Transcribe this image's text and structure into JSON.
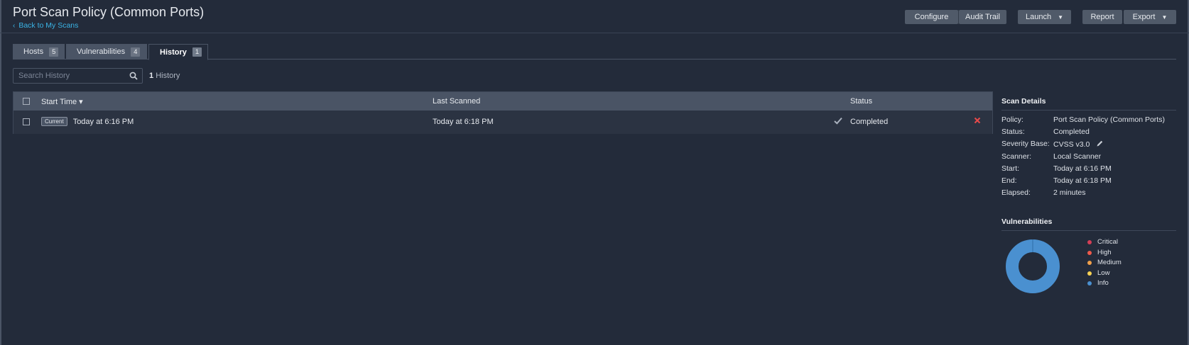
{
  "header": {
    "title": "Port Scan Policy (Common Ports)",
    "back_link": "Back to My Scans",
    "buttons": {
      "configure": "Configure",
      "audit_trail": "Audit Trail",
      "launch": "Launch",
      "report": "Report",
      "export": "Export"
    }
  },
  "tabs": [
    {
      "label": "Hosts",
      "count": "5"
    },
    {
      "label": "Vulnerabilities",
      "count": "4"
    },
    {
      "label": "History",
      "count": "1"
    }
  ],
  "search": {
    "placeholder": "Search History",
    "result_count": "1",
    "result_label": "History"
  },
  "table": {
    "columns": [
      "Start Time ▾",
      "Last Scanned",
      "Status"
    ],
    "rows": [
      {
        "badge": "Current",
        "start_time": "Today at 6:16 PM",
        "last_scanned": "Today at 6:18 PM",
        "status": "Completed"
      }
    ]
  },
  "scan_details": {
    "title": "Scan Details",
    "items": [
      {
        "label": "Policy:",
        "value": "Port Scan Policy (Common Ports)"
      },
      {
        "label": "Status:",
        "value": "Completed"
      },
      {
        "label": "Severity Base:",
        "value": "CVSS v3.0"
      },
      {
        "label": "Scanner:",
        "value": "Local Scanner"
      },
      {
        "label": "Start:",
        "value": "Today at 6:16 PM"
      },
      {
        "label": "End:",
        "value": "Today at 6:18 PM"
      },
      {
        "label": "Elapsed:",
        "value": "2 minutes"
      }
    ]
  },
  "vulnerabilities": {
    "title": "Vulnerabilities",
    "legend": [
      {
        "label": "Critical",
        "color": "#d43f56"
      },
      {
        "label": "High",
        "color": "#ee5a4b"
      },
      {
        "label": "Medium",
        "color": "#f0a04b"
      },
      {
        "label": "Low",
        "color": "#f7d154"
      },
      {
        "label": "Info",
        "color": "#4a90d0"
      }
    ],
    "counts": {
      "critical": 0,
      "high": 0,
      "medium": 0,
      "low": 0,
      "info": 4
    }
  },
  "colors": {
    "background": "#232b3a",
    "button": "#505a69",
    "link": "#3ab4e6",
    "info": "#4a90d0",
    "delete": "#e84a4a"
  }
}
